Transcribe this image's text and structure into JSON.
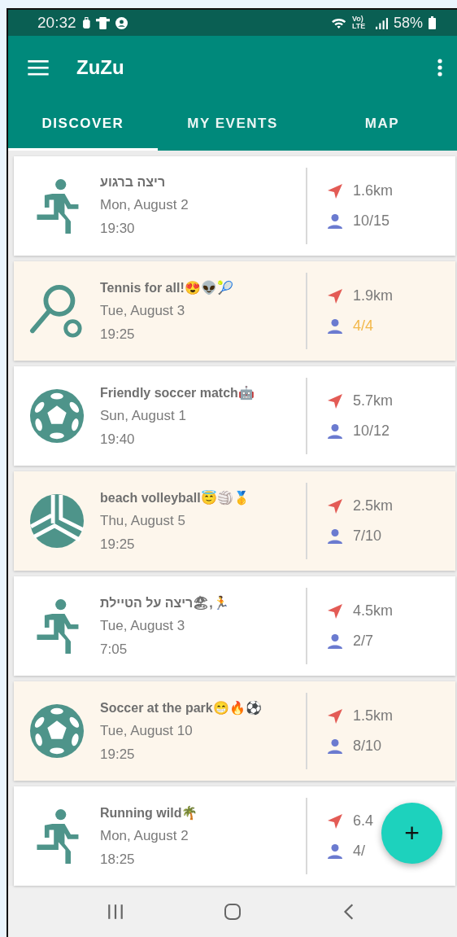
{
  "status_bar": {
    "time": "20:32",
    "network": "Vo) LTE",
    "battery": "58%"
  },
  "app_bar": {
    "title": "ZuZu"
  },
  "tabs": [
    {
      "label": "DISCOVER",
      "selected": true
    },
    {
      "label": "MY EVENTS",
      "selected": false
    },
    {
      "label": "MAP",
      "selected": false
    }
  ],
  "events": [
    {
      "kind": "running",
      "title": "ריצה ברגוע",
      "date": "Mon, August 2",
      "time": "19:30",
      "distance": "1.6km",
      "participants": "10/15",
      "highlighted": false,
      "full": false
    },
    {
      "kind": "tennis",
      "title": "Tennis for all!😍👽🎾",
      "date": "Tue, August 3",
      "time": "19:25",
      "distance": "1.9km",
      "participants": "4/4",
      "highlighted": true,
      "full": true
    },
    {
      "kind": "soccer",
      "title": "Friendly soccer match🤖",
      "date": "Sun, August 1",
      "time": "19:40",
      "distance": "5.7km",
      "participants": "10/12",
      "highlighted": false,
      "full": false
    },
    {
      "kind": "volleyball",
      "title": "beach volleyball😇🏐🥇",
      "date": "Thu, August 5",
      "time": "19:25",
      "distance": "2.5km",
      "participants": "7/10",
      "highlighted": true,
      "full": false
    },
    {
      "kind": "running",
      "title": "ריצה על הטיילת🏖,🏃",
      "date": "Tue, August 3",
      "time": "7:05",
      "distance": "4.5km",
      "participants": "2/7",
      "highlighted": false,
      "full": false
    },
    {
      "kind": "soccer",
      "title": "Soccer at the park😁🔥⚽",
      "date": "Tue, August 10",
      "time": "19:25",
      "distance": "1.5km",
      "participants": "8/10",
      "highlighted": true,
      "full": false
    },
    {
      "kind": "running",
      "title": "Running wild🌴",
      "date": "Mon, August 2",
      "time": "18:25",
      "distance": "6.4",
      "participants": "4/",
      "highlighted": false,
      "full": false
    }
  ],
  "fab": {
    "label": "+"
  }
}
